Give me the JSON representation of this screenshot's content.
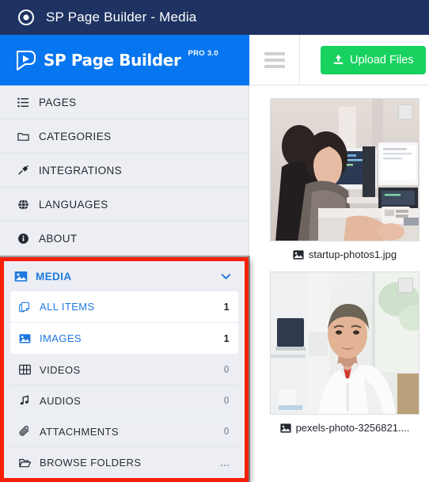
{
  "titlebar": {
    "icon": "record-circle-icon",
    "title": "SP Page Builder - Media"
  },
  "brand": {
    "logo_icon": "play-logo-icon",
    "name": "SP Page Builder",
    "edition": "PRO 3.0",
    "band_color": "#0675f0"
  },
  "toolbar": {
    "menu_icon": "hamburger-icon",
    "upload_label": "Upload Files",
    "upload_icon": "upload-icon",
    "upload_color": "#18d25f"
  },
  "sidebar": {
    "background": "#eceef4",
    "items": [
      {
        "label": "PAGES",
        "icon": "list-icon"
      },
      {
        "label": "CATEGORIES",
        "icon": "folder-icon"
      },
      {
        "label": "INTEGRATIONS",
        "icon": "plug-icon"
      },
      {
        "label": "LANGUAGES",
        "icon": "globe-icon"
      },
      {
        "label": "ABOUT",
        "icon": "info-circle-icon"
      }
    ],
    "media_group": {
      "highlight_color": "#fa1f06",
      "header": {
        "label": "MEDIA",
        "icon": "image-icon",
        "chevron": "chevron-down-icon",
        "color": "#1f7ae0"
      },
      "items": [
        {
          "label": "ALL ITEMS",
          "icon": "copy-icon",
          "count": "1",
          "active": true
        },
        {
          "label": "IMAGES",
          "icon": "image-icon",
          "count": "1",
          "active": true
        },
        {
          "label": "VIDEOS",
          "icon": "film-icon",
          "count": "0",
          "active": false
        },
        {
          "label": "AUDIOS",
          "icon": "music-note-icon",
          "count": "0",
          "active": false
        },
        {
          "label": "ATTACHMENTS",
          "icon": "paperclip-icon",
          "count": "0",
          "active": false
        },
        {
          "label": "BROWSE FOLDERS",
          "icon": "open-folder-icon",
          "count": "...",
          "active": false
        }
      ]
    }
  },
  "media_grid": {
    "items": [
      {
        "filename": "startup-photos1.jpg",
        "icon": "image-icon",
        "selected": false
      },
      {
        "filename": "pexels-photo-3256821....",
        "icon": "image-icon",
        "selected": false
      }
    ]
  }
}
